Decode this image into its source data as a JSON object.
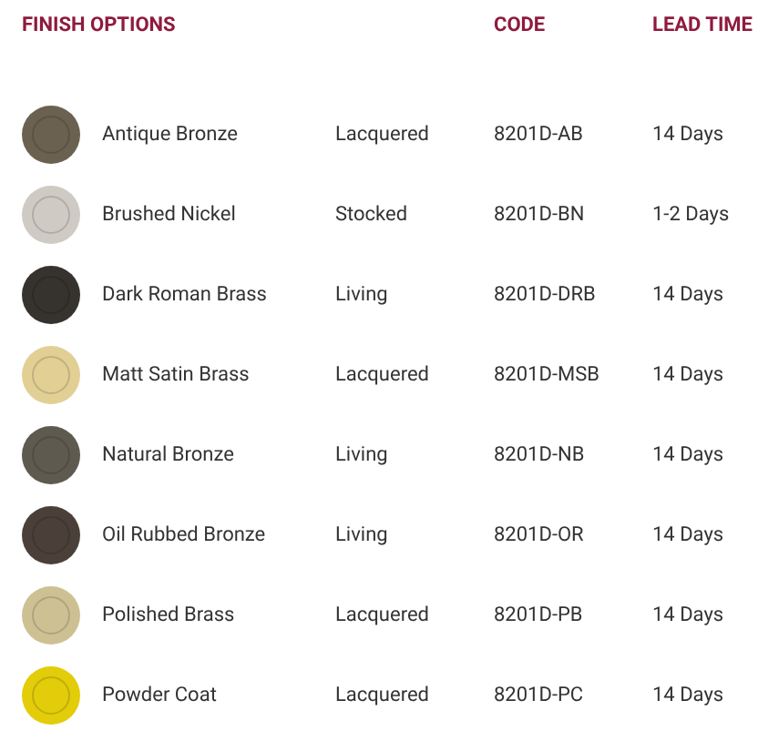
{
  "columns": [
    "FINISH OPTIONS",
    "CODE",
    "LEAD TIME"
  ],
  "rows": [
    {
      "finish": "Antique Bronze",
      "color": "#6b6150",
      "type": "Lacquered",
      "code": "8201D-AB",
      "lead_time": "14 Days"
    },
    {
      "finish": "Brushed Nickel",
      "color": "#cfcbc4",
      "type": "Stocked",
      "code": "8201D-BN",
      "lead_time": "1-2 Days"
    },
    {
      "finish": "Dark Roman Brass",
      "color": "#36322d",
      "type": "Living",
      "code": "8201D-DRB",
      "lead_time": "14 Days"
    },
    {
      "finish": "Matt Satin Brass",
      "color": "#e2cf94",
      "type": "Lacquered",
      "code": "8201D-MSB",
      "lead_time": "14 Days"
    },
    {
      "finish": "Natural Bronze",
      "color": "#5f5a50",
      "type": "Living",
      "code": "8201D-NB",
      "lead_time": "14 Days"
    },
    {
      "finish": "Oil Rubbed Bronze",
      "color": "#4a4039",
      "type": "Living",
      "code": "8201D-OR",
      "lead_time": "14 Days"
    },
    {
      "finish": "Polished Brass",
      "color": "#cdc193",
      "type": "Lacquered",
      "code": "8201D-PB",
      "lead_time": "14 Days"
    },
    {
      "finish": "Powder Coat",
      "color": "#e3cc0a",
      "type": "Lacquered",
      "code": "8201D-PC",
      "lead_time": "14 Days"
    }
  ]
}
